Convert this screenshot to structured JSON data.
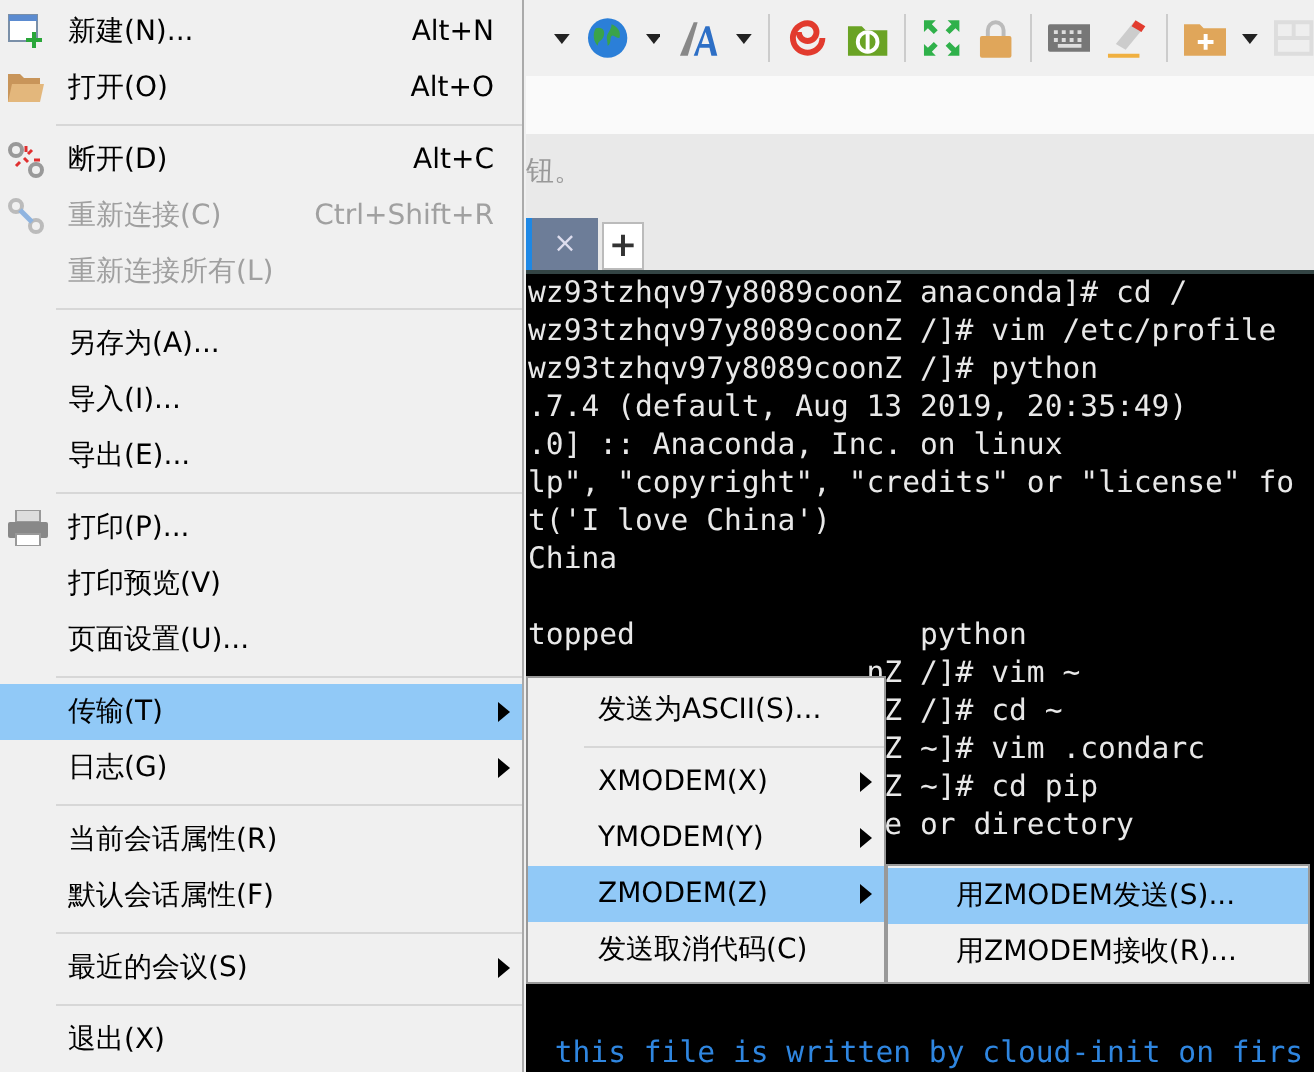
{
  "hint_text": "钮。",
  "tab": {
    "close": "×"
  },
  "new_tab": "+",
  "terminal": {
    "lines": [
      {
        "kind": "output",
        "text": "wz93tzhqv97y8089coonZ anaconda]# cd /"
      },
      {
        "kind": "output",
        "text": "wz93tzhqv97y8089coonZ /]# vim /etc/profile"
      },
      {
        "kind": "output",
        "text": "wz93tzhqv97y8089coonZ /]# python"
      },
      {
        "kind": "output",
        "text": ".7.4 (default, Aug 13 2019, 20:35:49)"
      },
      {
        "kind": "output",
        "text": ".0] :: Anaconda, Inc. on linux"
      },
      {
        "kind": "output",
        "text": "lp\", \"copyright\", \"credits\" or \"license\" fo"
      },
      {
        "kind": "output",
        "text": "t('I love China')"
      },
      {
        "kind": "output",
        "text": "China"
      },
      {
        "kind": "blank"
      },
      {
        "kind": "output",
        "text": "topped                python"
      },
      {
        "kind": "tail1",
        "text": "nZ /]# vim ~"
      },
      {
        "kind": "tail",
        "text": "Z /]# cd ~"
      },
      {
        "kind": "tail",
        "text": "Z ~]# vim .condarc"
      },
      {
        "kind": "tail",
        "text": "Z ~]# cd pip"
      },
      {
        "kind": "tail",
        "text": "e or directory"
      },
      {
        "kind": "blank"
      },
      {
        "kind": "blank"
      },
      {
        "kind": "blank"
      },
      {
        "kind": "blank"
      },
      {
        "kind": "blank"
      },
      {
        "kind": "comment",
        "text": "this file is written by cloud-init on firs"
      }
    ]
  },
  "menu": {
    "items": [
      {
        "kind": "item",
        "label": "新建(N)...",
        "shortcut": "Alt+N",
        "disabled": false,
        "selected": false,
        "has_submenu": false
      },
      {
        "kind": "item",
        "label": "打开(O)",
        "shortcut": "Alt+O",
        "disabled": false,
        "selected": false,
        "has_submenu": false
      },
      {
        "kind": "separator"
      },
      {
        "kind": "item",
        "label": "断开(D)",
        "shortcut": "Alt+C",
        "disabled": false,
        "selected": false,
        "has_submenu": false
      },
      {
        "kind": "item",
        "label": "重新连接(C)",
        "shortcut": "Ctrl+Shift+R",
        "disabled": true,
        "selected": false,
        "has_submenu": false
      },
      {
        "kind": "item",
        "label": "重新连接所有(L)",
        "disabled": true,
        "selected": false,
        "has_submenu": false
      },
      {
        "kind": "separator"
      },
      {
        "kind": "item",
        "label": "另存为(A)...",
        "disabled": false,
        "selected": false,
        "has_submenu": false
      },
      {
        "kind": "item",
        "label": "导入(I)...",
        "disabled": false,
        "selected": false,
        "has_submenu": false
      },
      {
        "kind": "item",
        "label": "导出(E)...",
        "disabled": false,
        "selected": false,
        "has_submenu": false
      },
      {
        "kind": "separator"
      },
      {
        "kind": "item",
        "label": "打印(P)...",
        "disabled": false,
        "selected": false,
        "has_submenu": false
      },
      {
        "kind": "item",
        "label": "打印预览(V)",
        "disabled": false,
        "selected": false,
        "has_submenu": false
      },
      {
        "kind": "item",
        "label": "页面设置(U)...",
        "disabled": false,
        "selected": false,
        "has_submenu": false
      },
      {
        "kind": "separator"
      },
      {
        "kind": "item",
        "label": "传输(T)",
        "disabled": false,
        "selected": true,
        "has_submenu": true
      },
      {
        "kind": "item",
        "label": "日志(G)",
        "disabled": false,
        "selected": false,
        "has_submenu": true
      },
      {
        "kind": "separator"
      },
      {
        "kind": "item",
        "label": "当前会话属性(R)",
        "disabled": false,
        "selected": false,
        "has_submenu": false
      },
      {
        "kind": "item",
        "label": "默认会话属性(F)",
        "disabled": false,
        "selected": false,
        "has_submenu": false
      },
      {
        "kind": "separator"
      },
      {
        "kind": "item",
        "label": "最近的会议(S)",
        "disabled": false,
        "selected": false,
        "has_submenu": true
      },
      {
        "kind": "separator"
      },
      {
        "kind": "item",
        "label": "退出(X)",
        "disabled": false,
        "selected": false,
        "has_submenu": false
      }
    ]
  },
  "submenu": {
    "items": [
      {
        "kind": "item",
        "label": "发送为ASCII(S)...",
        "selected": false,
        "has_submenu": false
      },
      {
        "kind": "separator"
      },
      {
        "kind": "item",
        "label": "XMODEM(X)",
        "selected": false,
        "has_submenu": true
      },
      {
        "kind": "item",
        "label": "YMODEM(Y)",
        "selected": false,
        "has_submenu": true
      },
      {
        "kind": "item",
        "label": "ZMODEM(Z)",
        "selected": true,
        "has_submenu": true
      },
      {
        "kind": "item",
        "label": "发送取消代码(C)",
        "selected": false,
        "has_submenu": false
      }
    ]
  },
  "sub_submenu": {
    "items": [
      {
        "kind": "item",
        "label": "用ZMODEM发送(S)...",
        "selected": true
      },
      {
        "kind": "item",
        "label": "用ZMODEM接收(R)...",
        "selected": false
      }
    ]
  }
}
